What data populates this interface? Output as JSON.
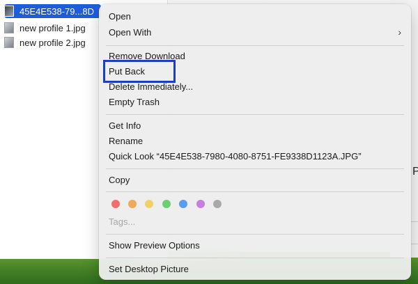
{
  "finder": {
    "files": [
      {
        "name": "45E4E538-79...8D",
        "selected": true
      },
      {
        "name": "new profile 1.jpg",
        "selected": false
      },
      {
        "name": "new profile 2.jpg",
        "selected": false
      }
    ]
  },
  "context_menu": {
    "open": "Open",
    "open_with": "Open With",
    "remove_download": "Remove Download",
    "put_back": "Put Back",
    "delete_immediately": "Delete Immediately...",
    "empty_trash": "Empty Trash",
    "get_info": "Get Info",
    "rename": "Rename",
    "quick_look": "Quick Look “45E4E538-7980-4080-8751-FE9338D1123A.JPG”",
    "copy": "Copy",
    "tags_placeholder": "Tags...",
    "show_preview_options": "Show Preview Options",
    "set_desktop_picture": "Set Desktop Picture",
    "tag_colors": [
      "#ef6f6c",
      "#f3a85a",
      "#f1d067",
      "#6ccf73",
      "#5b9bf0",
      "#c67ee0",
      "#a9a9a9"
    ]
  },
  "right_pane": {
    "letter": "P"
  },
  "highlight_color": "#1c3fbf"
}
